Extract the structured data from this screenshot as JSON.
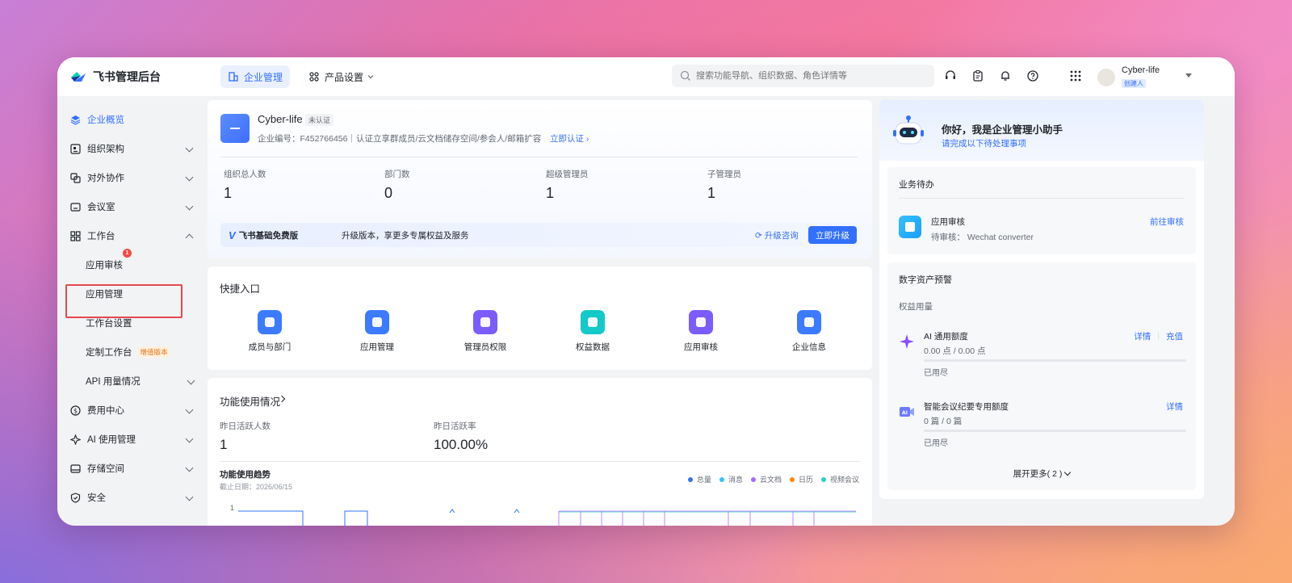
{
  "header": {
    "brand": "飞书管理后台",
    "tabs": [
      {
        "label": "企业管理",
        "active": true
      },
      {
        "label": "产品设置",
        "active": false
      }
    ],
    "search_placeholder": "搜索功能导航、组织数据、角色详情等",
    "user": {
      "name": "Cyber-life",
      "role": "创建人"
    }
  },
  "sidebar": {
    "items": [
      {
        "label": "企业概览",
        "icon": "layers-icon"
      },
      {
        "label": "组织架构",
        "icon": "org-icon"
      },
      {
        "label": "对外协作",
        "icon": "collab-icon"
      },
      {
        "label": "会议室",
        "icon": "meeting-room-icon"
      },
      {
        "label": "工作台",
        "icon": "workbench-icon"
      },
      {
        "label": "费用中心",
        "icon": "dollar-icon"
      },
      {
        "label": "AI 使用管理",
        "icon": "ai-icon"
      },
      {
        "label": "存储空间",
        "icon": "storage-icon"
      },
      {
        "label": "安全",
        "icon": "shield-icon"
      }
    ],
    "sub_items": [
      {
        "label": "应用审核",
        "badge": "1"
      },
      {
        "label": "应用管理"
      },
      {
        "label": "工作台设置"
      },
      {
        "label": "定制工作台",
        "tag": "增值版本"
      },
      {
        "label": "API 用量情况"
      }
    ]
  },
  "org": {
    "name": "Cyber-life",
    "status": "未认证",
    "meta": "企业编号：F452766456｜认证立享群成员/云文档储存空间/参会人/邮箱扩容",
    "verify_link": "立即认证",
    "stats": [
      {
        "label": "组织总人数",
        "value": "1"
      },
      {
        "label": "部门数",
        "value": "0"
      },
      {
        "label": "超级管理员",
        "value": "1"
      },
      {
        "label": "子管理员",
        "value": "1"
      }
    ],
    "plan": {
      "name": "飞书基础免费版",
      "text": "升级版本，享更多专属权益及服务",
      "consult": "升级咨询",
      "button": "立即升级"
    }
  },
  "quick": {
    "title": "快捷入口",
    "items": [
      {
        "label": "成员与部门",
        "color": "#3c7bff"
      },
      {
        "label": "应用管理",
        "color": "#3c7bff"
      },
      {
        "label": "管理员权限",
        "color": "#7a5cff"
      },
      {
        "label": "权益数据",
        "color": "#14c9c9"
      },
      {
        "label": "应用审核",
        "color": "#7a5cff"
      },
      {
        "label": "企业信息",
        "color": "#3c7bff"
      }
    ]
  },
  "usage": {
    "title": "功能使用情况",
    "stats": [
      {
        "label": "昨日活跃人数",
        "value": "1"
      },
      {
        "label": "昨日活跃率",
        "value": "100.00%"
      }
    ],
    "trend_title": "功能使用趋势",
    "trend_date": "截止日期：2026/06/15",
    "legend": [
      {
        "label": "总量",
        "color": "#3370ff"
      },
      {
        "label": "消息",
        "color": "#34c5f3"
      },
      {
        "label": "云文档",
        "color": "#a66bff"
      },
      {
        "label": "日历",
        "color": "#ff8800"
      },
      {
        "label": "视频会议",
        "color": "#2ccfc4"
      }
    ],
    "y_tick": "1"
  },
  "assistant": {
    "title": "你好，我是企业管理小助手",
    "subtitle": "请完成以下待处理事项",
    "todo": {
      "title": "业务待办",
      "item": "应用审核",
      "detail": "待审核： Wechat converter",
      "link": "前往审核"
    },
    "assets": {
      "title": "数字资产预警",
      "subtitle": "权益用量",
      "rows": [
        {
          "name": "AI 通用额度",
          "value": "0.00 点 / 0.00 点",
          "status": "已用尽",
          "links": [
            "详情",
            "充值"
          ]
        },
        {
          "name": "智能会议纪要专用额度",
          "value": "0 篇 / 0 篇",
          "status": "已用尽",
          "links": [
            "详情"
          ]
        }
      ],
      "expand": "展开更多( 2 )"
    }
  }
}
